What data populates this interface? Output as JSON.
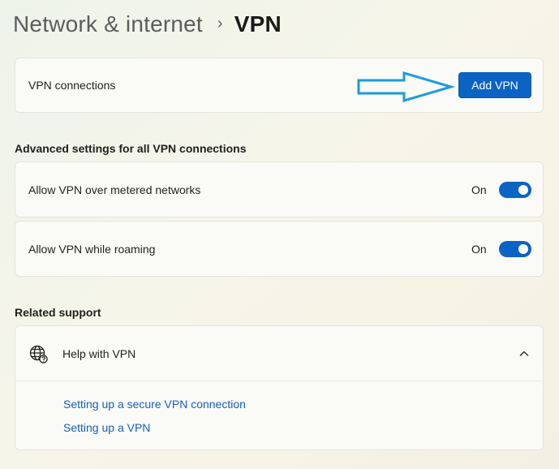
{
  "breadcrumb": {
    "parent": "Network & internet",
    "separator": "›",
    "current": "VPN"
  },
  "vpn_connections": {
    "label": "VPN connections",
    "add_button": "Add VPN"
  },
  "advanced": {
    "title": "Advanced settings for all VPN connections",
    "settings": [
      {
        "label": "Allow VPN over metered networks",
        "state": "On"
      },
      {
        "label": "Allow VPN while roaming",
        "state": "On"
      }
    ]
  },
  "related_support": {
    "title": "Related support",
    "help_item": {
      "label": "Help with VPN",
      "expanded": true
    },
    "links": [
      "Setting up a secure VPN connection",
      "Setting up a VPN"
    ]
  },
  "colors": {
    "accent": "#0b63c4",
    "link": "#1361b8",
    "annotation_arrow": "#1e9bd7"
  }
}
